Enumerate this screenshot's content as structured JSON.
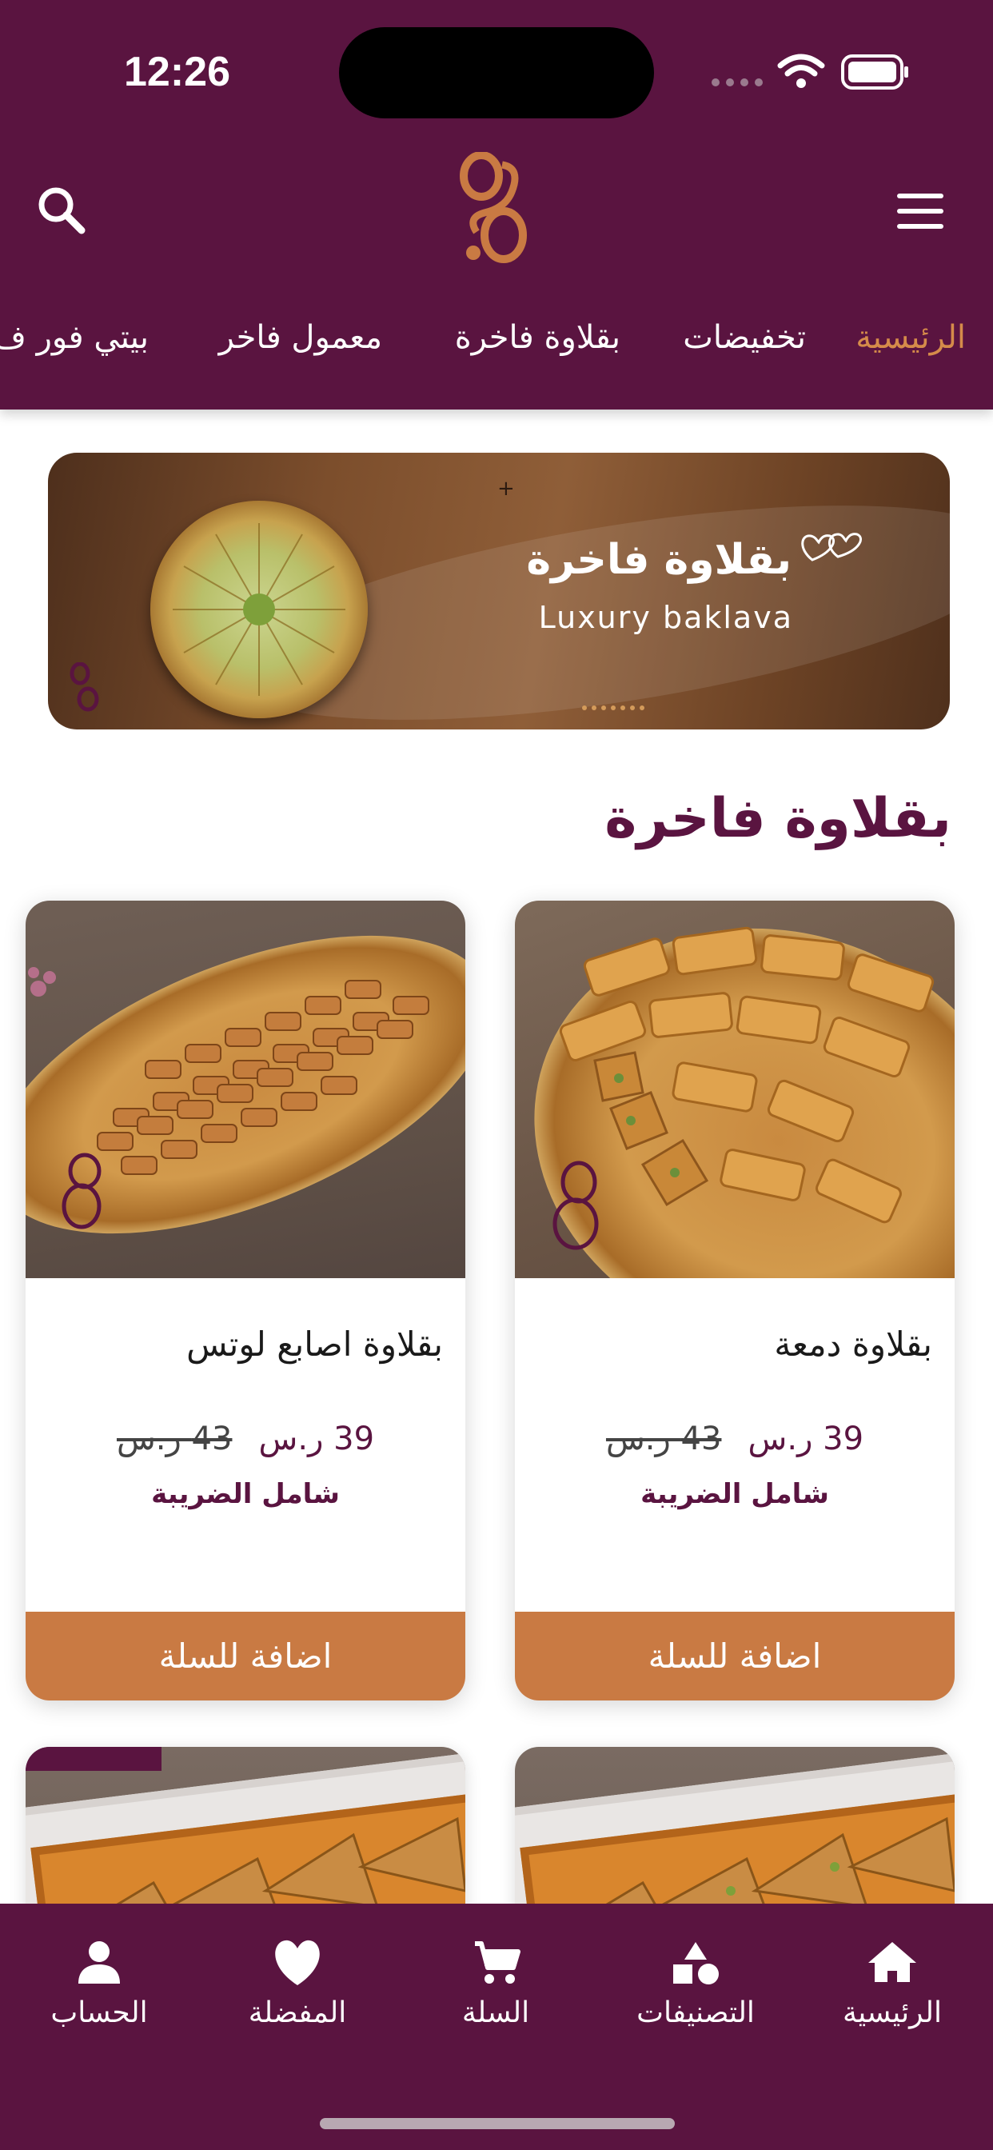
{
  "status_bar": {
    "time": "12:26"
  },
  "header": {
    "search_icon": "search-icon",
    "menu_icon": "hamburger-menu-icon",
    "logo": "brand-logo"
  },
  "nav_tabs": [
    {
      "label": "الرئيسية",
      "active": true
    },
    {
      "label": "تخفيضات",
      "active": false
    },
    {
      "label": "بقلاوة فاخرة",
      "active": false
    },
    {
      "label": "معمول فاخر",
      "active": false
    },
    {
      "label": "بيتي فور ف",
      "active": false
    }
  ],
  "banner": {
    "title_ar": "بقلاوة فاخرة",
    "title_en": "Luxury baklava"
  },
  "section": {
    "title": "بقلاوة فاخرة"
  },
  "products": [
    {
      "name": "بقلاوة دمعة",
      "price": "39 ر.س",
      "old_price": "43 ر.س",
      "tax_note": "شامل الضريبة",
      "add_label": "اضافة للسلة"
    },
    {
      "name": "بقلاوة اصابع لوتس",
      "price": "39 ر.س",
      "old_price": "43 ر.س",
      "tax_note": "شامل الضريبة",
      "add_label": "اضافة للسلة"
    }
  ],
  "bottom_nav": [
    {
      "label": "الرئيسية",
      "icon": "home-icon"
    },
    {
      "label": "التصنيفات",
      "icon": "categories-icon"
    },
    {
      "label": "السلة",
      "icon": "cart-icon"
    },
    {
      "label": "المفضلة",
      "icon": "heart-icon"
    },
    {
      "label": "الحساب",
      "icon": "user-icon"
    }
  ],
  "colors": {
    "primary": "#5a1440",
    "accent": "#c97a43",
    "active_tab": "#d58b4a"
  }
}
